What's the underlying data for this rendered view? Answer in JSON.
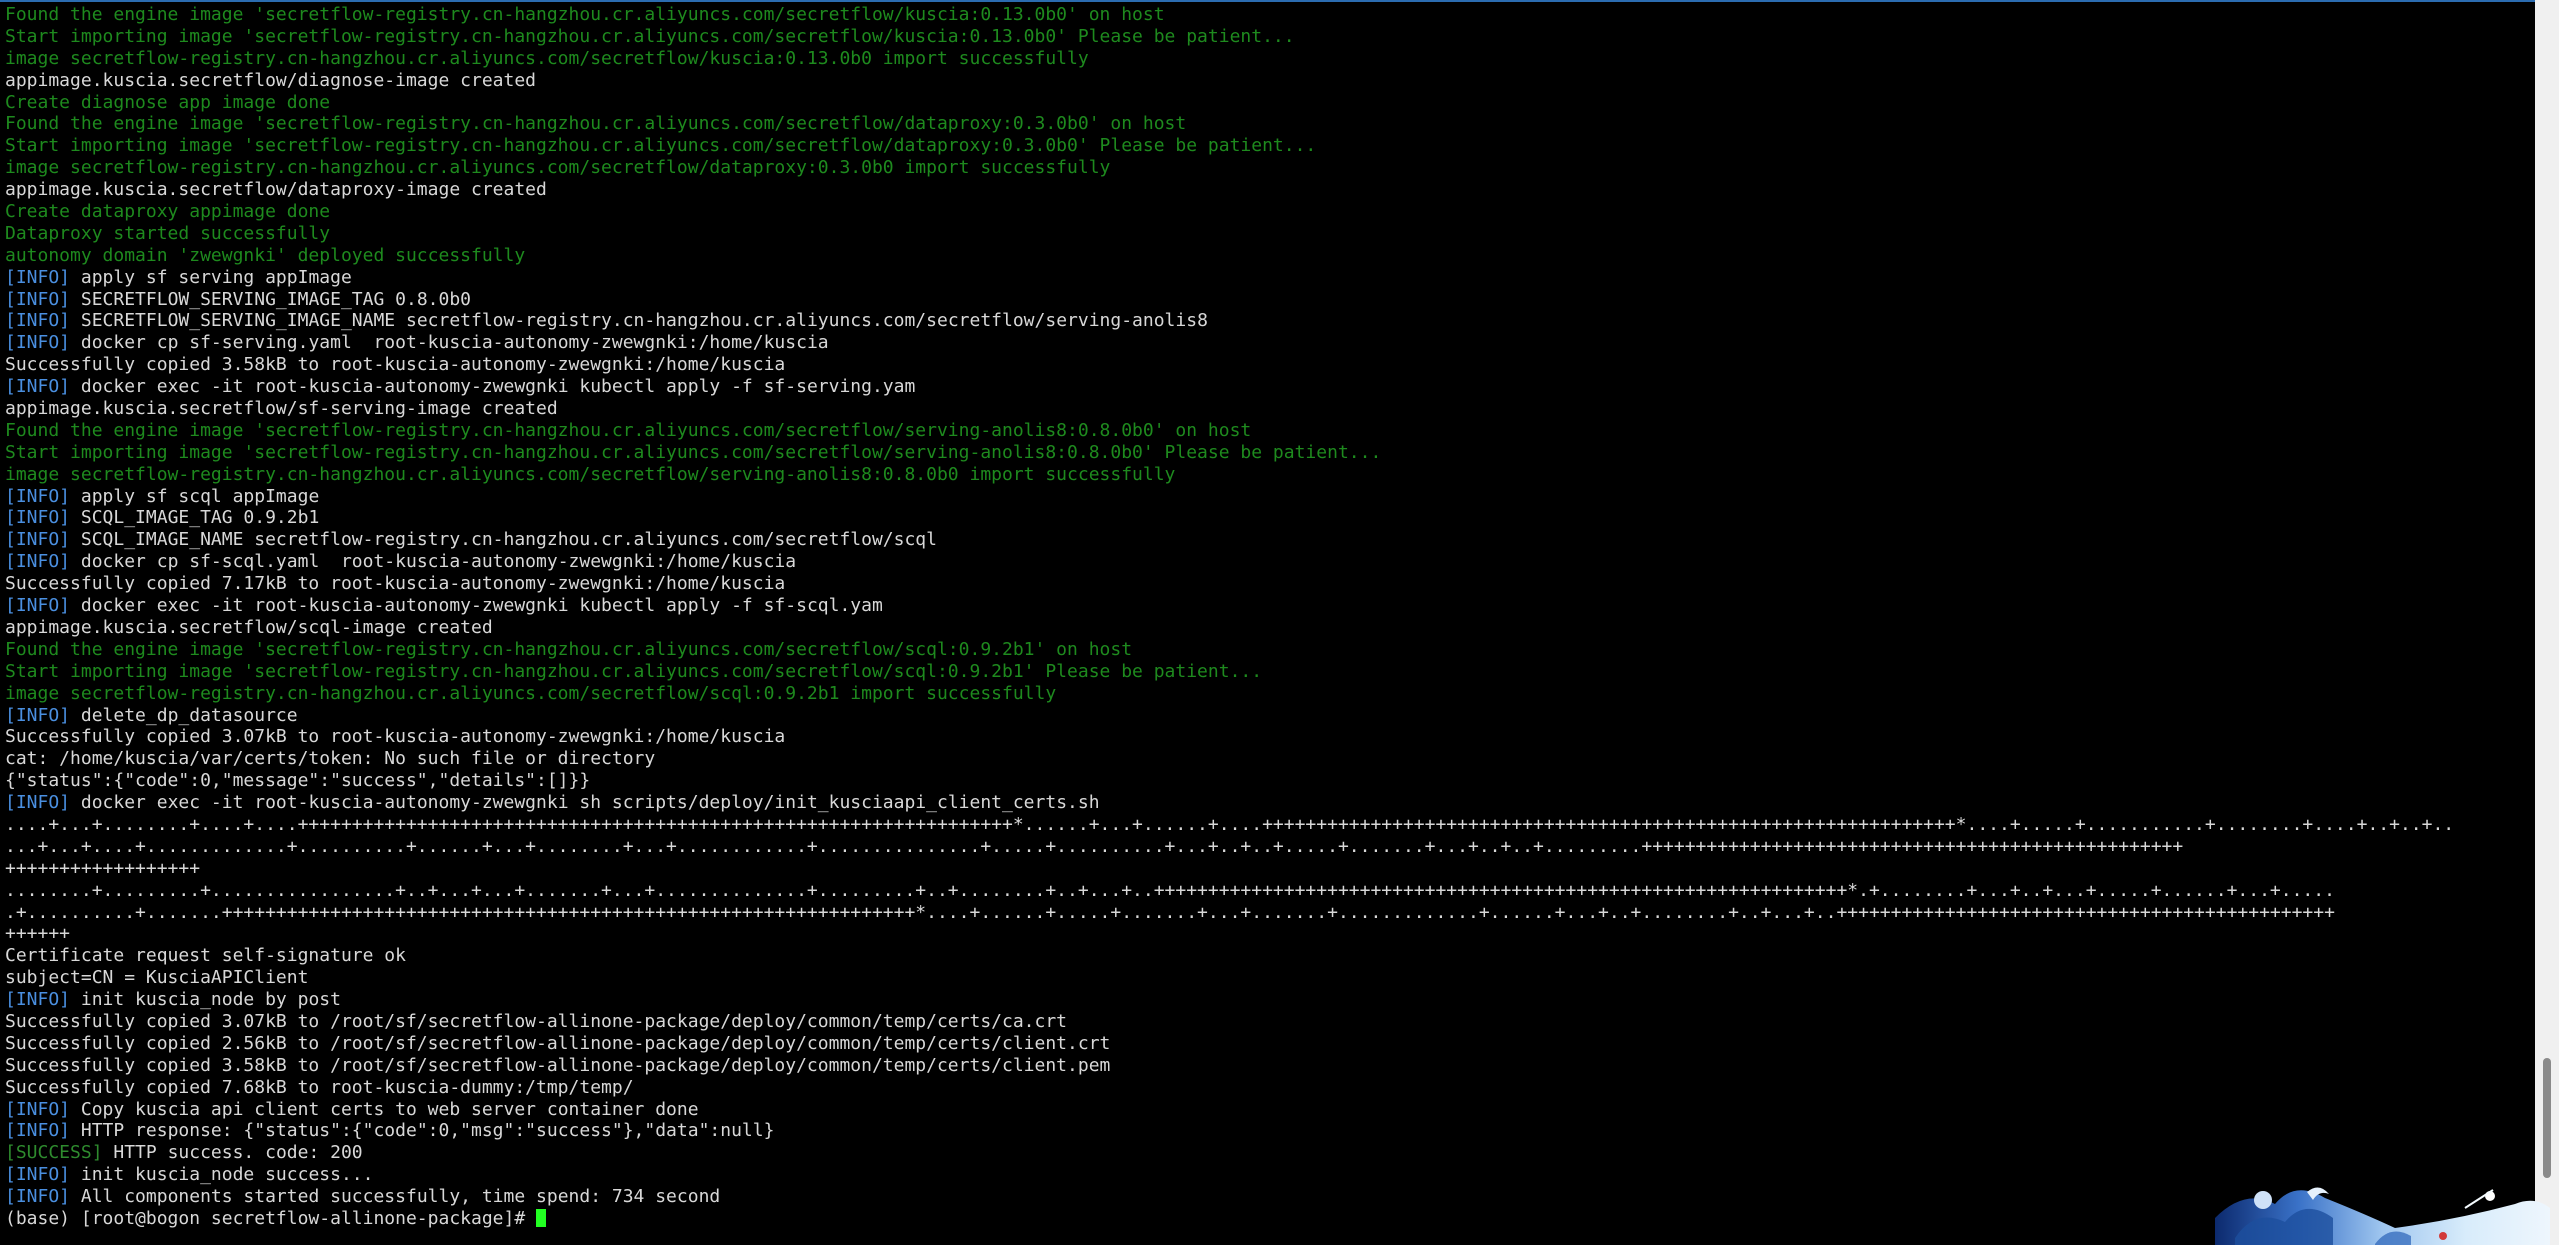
{
  "terminal": {
    "colors": {
      "background": "#000000",
      "default": "#d8d8d8",
      "green": "#1e8a1e",
      "info": "#4a8fe0",
      "success_tag": "#2e8b2e",
      "cursor": "#22ff22",
      "scrollbar_thumb": "#8a8a8a"
    },
    "scroll_position": 0.94,
    "lines": [
      {
        "color": "green",
        "text": "Found the engine image 'secretflow-registry.cn-hangzhou.cr.aliyuncs.com/secretflow/kuscia:0.13.0b0' on host"
      },
      {
        "color": "green",
        "text": "Start importing image 'secretflow-registry.cn-hangzhou.cr.aliyuncs.com/secretflow/kuscia:0.13.0b0' Please be patient..."
      },
      {
        "color": "green",
        "text": "image secretflow-registry.cn-hangzhou.cr.aliyuncs.com/secretflow/kuscia:0.13.0b0 import successfully"
      },
      {
        "color": "default",
        "text": "appimage.kuscia.secretflow/diagnose-image created"
      },
      {
        "color": "green",
        "text": "Create diagnose app image done"
      },
      {
        "color": "green",
        "text": "Found the engine image 'secretflow-registry.cn-hangzhou.cr.aliyuncs.com/secretflow/dataproxy:0.3.0b0' on host"
      },
      {
        "color": "green",
        "text": "Start importing image 'secretflow-registry.cn-hangzhou.cr.aliyuncs.com/secretflow/dataproxy:0.3.0b0' Please be patient..."
      },
      {
        "color": "green",
        "text": "image secretflow-registry.cn-hangzhou.cr.aliyuncs.com/secretflow/dataproxy:0.3.0b0 import successfully"
      },
      {
        "color": "default",
        "text": "appimage.kuscia.secretflow/dataproxy-image created"
      },
      {
        "color": "green",
        "text": "Create dataproxy appimage done"
      },
      {
        "color": "green",
        "text": "Dataproxy started successfully"
      },
      {
        "color": "green",
        "text": "autonomy domain 'zwewgnki' deployed successfully"
      },
      {
        "tag": "[INFO]",
        "text": " apply sf serving appImage"
      },
      {
        "tag": "[INFO]",
        "text": " SECRETFLOW_SERVING_IMAGE_TAG 0.8.0b0"
      },
      {
        "tag": "[INFO]",
        "text": " SECRETFLOW_SERVING_IMAGE_NAME secretflow-registry.cn-hangzhou.cr.aliyuncs.com/secretflow/serving-anolis8"
      },
      {
        "tag": "[INFO]",
        "text": " docker cp sf-serving.yaml  root-kuscia-autonomy-zwewgnki:/home/kuscia"
      },
      {
        "color": "default",
        "text": "Successfully copied 3.58kB to root-kuscia-autonomy-zwewgnki:/home/kuscia"
      },
      {
        "tag": "[INFO]",
        "text": " docker exec -it root-kuscia-autonomy-zwewgnki kubectl apply -f sf-serving.yam"
      },
      {
        "color": "default",
        "text": "appimage.kuscia.secretflow/sf-serving-image created"
      },
      {
        "color": "green",
        "text": "Found the engine image 'secretflow-registry.cn-hangzhou.cr.aliyuncs.com/secretflow/serving-anolis8:0.8.0b0' on host"
      },
      {
        "color": "green",
        "text": "Start importing image 'secretflow-registry.cn-hangzhou.cr.aliyuncs.com/secretflow/serving-anolis8:0.8.0b0' Please be patient..."
      },
      {
        "color": "green",
        "text": "image secretflow-registry.cn-hangzhou.cr.aliyuncs.com/secretflow/serving-anolis8:0.8.0b0 import successfully"
      },
      {
        "tag": "[INFO]",
        "text": " apply sf scql appImage"
      },
      {
        "tag": "[INFO]",
        "text": " SCQL_IMAGE_TAG 0.9.2b1"
      },
      {
        "tag": "[INFO]",
        "text": " SCQL_IMAGE_NAME secretflow-registry.cn-hangzhou.cr.aliyuncs.com/secretflow/scql"
      },
      {
        "tag": "[INFO]",
        "text": " docker cp sf-scql.yaml  root-kuscia-autonomy-zwewgnki:/home/kuscia"
      },
      {
        "color": "default",
        "text": "Successfully copied 7.17kB to root-kuscia-autonomy-zwewgnki:/home/kuscia"
      },
      {
        "tag": "[INFO]",
        "text": " docker exec -it root-kuscia-autonomy-zwewgnki kubectl apply -f sf-scql.yam"
      },
      {
        "color": "default",
        "text": "appimage.kuscia.secretflow/scql-image created"
      },
      {
        "color": "green",
        "text": "Found the engine image 'secretflow-registry.cn-hangzhou.cr.aliyuncs.com/secretflow/scql:0.9.2b1' on host"
      },
      {
        "color": "green",
        "text": "Start importing image 'secretflow-registry.cn-hangzhou.cr.aliyuncs.com/secretflow/scql:0.9.2b1' Please be patient..."
      },
      {
        "color": "green",
        "text": "image secretflow-registry.cn-hangzhou.cr.aliyuncs.com/secretflow/scql:0.9.2b1 import successfully"
      },
      {
        "tag": "[INFO]",
        "text": " delete_dp_datasource"
      },
      {
        "color": "default",
        "text": "Successfully copied 3.07kB to root-kuscia-autonomy-zwewgnki:/home/kuscia"
      },
      {
        "color": "default",
        "text": "cat: /home/kuscia/var/certs/token: No such file or directory"
      },
      {
        "color": "default",
        "text": "{\"status\":{\"code\":0,\"message\":\"success\",\"details\":[]}}"
      },
      {
        "tag": "[INFO]",
        "text": " docker exec -it root-kuscia-autonomy-zwewgnki sh scripts/deploy/init_kusciaapi_client_certs.sh"
      },
      {
        "color": "default",
        "text": "....+...+........+....+....++++++++++++++++++++++++++++++++++++++++++++++++++++++++++++++++++*......+...+......+....++++++++++++++++++++++++++++++++++++++++++++++++++++++++++++++++*....+.....+...........+........+....+..+..+.."
      },
      {
        "color": "default",
        "text": "...+...+....+.............+..........+......+...+........+...+............+...............+.....+..........+...+..+..+.....+.......+...+..+..+.........++++++++++++++++++++++++++++++++++++++++++++++++++"
      },
      {
        "color": "default",
        "text": "++++++++++++++++++"
      },
      {
        "color": "default",
        "text": "........+.........+.................+..+...+...+.......+...+..............+.........+..+........+..+...+..++++++++++++++++++++++++++++++++++++++++++++++++++++++++++++++++*.+........+...+..+...+.....+......+...+....."
      },
      {
        "color": "default",
        "text": ".+..........+.......++++++++++++++++++++++++++++++++++++++++++++++++++++++++++++++++*....+......+.....+.......+...+.......+.............+......+...+..+........+..+...+..++++++++++++++++++++++++++++++++++++++++++++++"
      },
      {
        "color": "default",
        "text": "++++++"
      },
      {
        "color": "default",
        "text": "Certificate request self-signature ok"
      },
      {
        "color": "default",
        "text": "subject=CN = KusciaAPIClient"
      },
      {
        "tag": "[INFO]",
        "text": " init kuscia_node by post"
      },
      {
        "color": "default",
        "text": "Successfully copied 3.07kB to /root/sf/secretflow-allinone-package/deploy/common/temp/certs/ca.crt"
      },
      {
        "color": "default",
        "text": "Successfully copied 2.56kB to /root/sf/secretflow-allinone-package/deploy/common/temp/certs/client.crt"
      },
      {
        "color": "default",
        "text": "Successfully copied 3.58kB to /root/sf/secretflow-allinone-package/deploy/common/temp/certs/client.pem"
      },
      {
        "color": "default",
        "text": "Successfully copied 7.68kB to root-kuscia-dummy:/tmp/temp/"
      },
      {
        "tag": "[INFO]",
        "text": " Copy kuscia api client certs to web server container done"
      },
      {
        "tag": "[INFO]",
        "text": " HTTP response: {\"status\":{\"code\":0,\"msg\":\"success\"},\"data\":null}"
      },
      {
        "tag": "[SUCCESS]",
        "tag_color": "success_tag",
        "text": " HTTP success. code: 200"
      },
      {
        "tag": "[INFO]",
        "text": " init kuscia_node success..."
      },
      {
        "tag": "[INFO]",
        "text": " All components started successfully, time spend: 734 second"
      },
      {
        "color": "default",
        "text": "(base) [root@bogon secretflow-allinone-package]# ",
        "cursor": true
      }
    ]
  }
}
